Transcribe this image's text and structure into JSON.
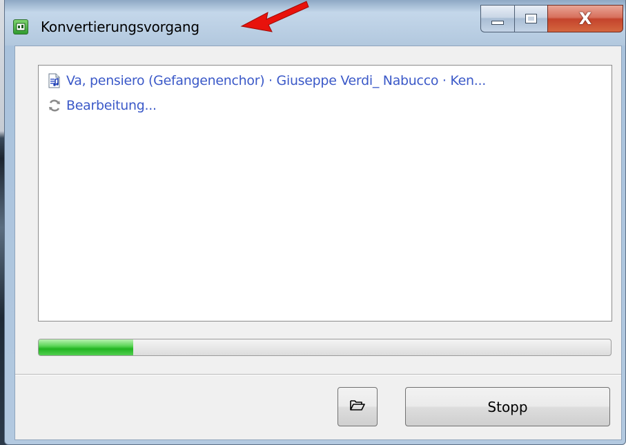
{
  "window": {
    "title": "Konvertierungsvorgang",
    "app_icon": "converter-app-icon",
    "caption_buttons": {
      "minimize_icon": "minimize-icon",
      "maximize_icon": "maximize-icon",
      "close_label": "X"
    }
  },
  "log": {
    "items": [
      {
        "icon": "audio-file-icon",
        "text": "Va, pensiero (Gefangenenchor) · Giuseppe Verdi_ Nabucco · Ken..."
      },
      {
        "icon": "refresh-icon",
        "text": "Bearbeitung..."
      }
    ]
  },
  "progress": {
    "fraction": 0.165,
    "color": "#2fbf2c"
  },
  "buttons": {
    "open_folder_icon": "folder-open-icon",
    "stop_label": "Stopp"
  },
  "annotation": {
    "arrow_color": "#e8120c"
  }
}
